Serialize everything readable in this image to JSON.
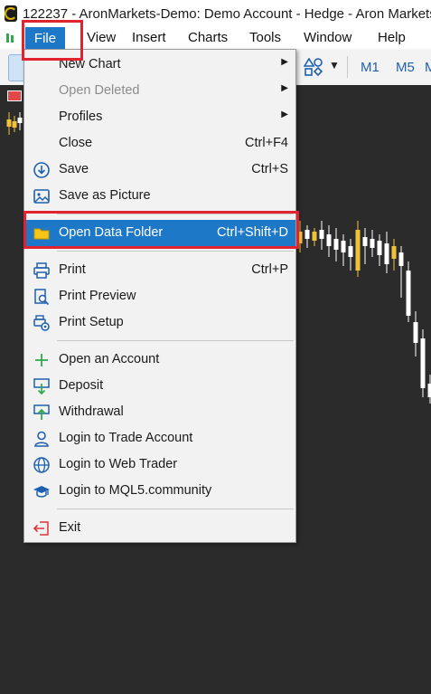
{
  "window": {
    "title": "122237 - AronMarkets-Demo: Demo Account - Hedge - Aron Markets"
  },
  "menubar": {
    "items": [
      {
        "label": "File"
      },
      {
        "label": "View"
      },
      {
        "label": "Insert"
      },
      {
        "label": "Charts"
      },
      {
        "label": "Tools"
      },
      {
        "label": "Window"
      },
      {
        "label": "Help"
      }
    ]
  },
  "toolbar": {
    "timeframes": [
      "M1",
      "M5",
      "M"
    ]
  },
  "file_menu": {
    "items": [
      {
        "label": "New Chart",
        "shortcut": "",
        "submenu": true
      },
      {
        "label": "Open Deleted",
        "shortcut": "",
        "submenu": true,
        "disabled": true
      },
      {
        "label": "Profiles",
        "shortcut": "",
        "submenu": true
      },
      {
        "label": "Close",
        "shortcut": "Ctrl+F4"
      },
      {
        "label": "Save",
        "shortcut": "Ctrl+S",
        "icon": "save-icon"
      },
      {
        "label": "Save as Picture",
        "shortcut": "",
        "icon": "picture-icon"
      },
      {
        "label": "Open Data Folder",
        "shortcut": "Ctrl+Shift+D",
        "icon": "folder-icon",
        "highlighted": true
      },
      {
        "label": "Print",
        "shortcut": "Ctrl+P",
        "icon": "printer-icon"
      },
      {
        "label": "Print Preview",
        "shortcut": "",
        "icon": "print-preview-icon"
      },
      {
        "label": "Print Setup",
        "shortcut": "",
        "icon": "print-setup-icon"
      },
      {
        "label": "Open an Account",
        "shortcut": "",
        "icon": "plus-icon"
      },
      {
        "label": "Deposit",
        "shortcut": "",
        "icon": "deposit-icon"
      },
      {
        "label": "Withdrawal",
        "shortcut": "",
        "icon": "withdrawal-icon"
      },
      {
        "label": "Login to Trade Account",
        "shortcut": "",
        "icon": "user-icon"
      },
      {
        "label": "Login to Web Trader",
        "shortcut": "",
        "icon": "globe-icon"
      },
      {
        "label": "Login to MQL5.community",
        "shortcut": "",
        "icon": "graduation-cap-icon"
      },
      {
        "label": "Exit",
        "shortcut": "",
        "icon": "exit-icon"
      }
    ]
  },
  "colors": {
    "menu_highlight": "#1e78c8",
    "annotation_red": "#e0232e",
    "bull_candle": "#f0c23b",
    "bear_candle": "#ffffff",
    "chart_bg": "#2b2b2b"
  }
}
